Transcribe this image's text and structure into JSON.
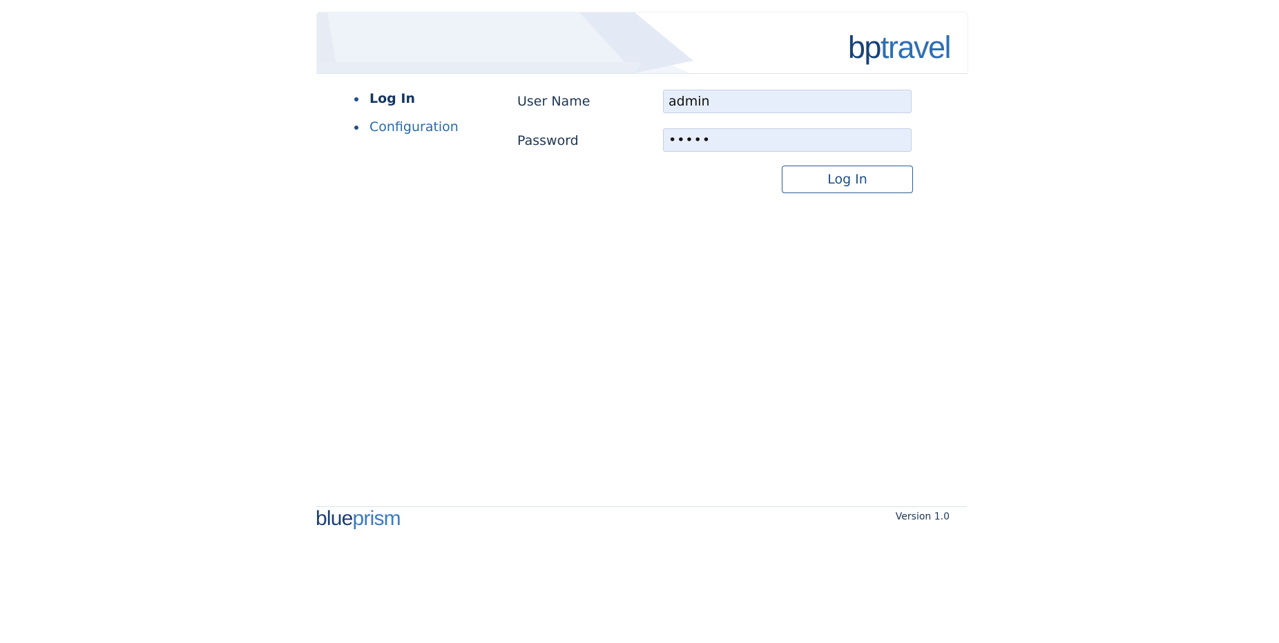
{
  "header": {
    "brand_part1": "bp",
    "brand_part2": "travel"
  },
  "nav": {
    "items": [
      {
        "label": "Log In",
        "active": true
      },
      {
        "label": "Configuration",
        "active": false
      }
    ]
  },
  "login_form": {
    "username_label": "User Name",
    "username_value": "admin",
    "password_label": "Password",
    "password_value": "•••••",
    "submit_label": "Log In"
  },
  "footer": {
    "logo_part1": "blue",
    "logo_part2": "prism",
    "version": "Version 1.0"
  },
  "colors": {
    "brand": "#1b4f8c",
    "link": "#2a6aa8",
    "input_bg": "#e7eefb"
  }
}
